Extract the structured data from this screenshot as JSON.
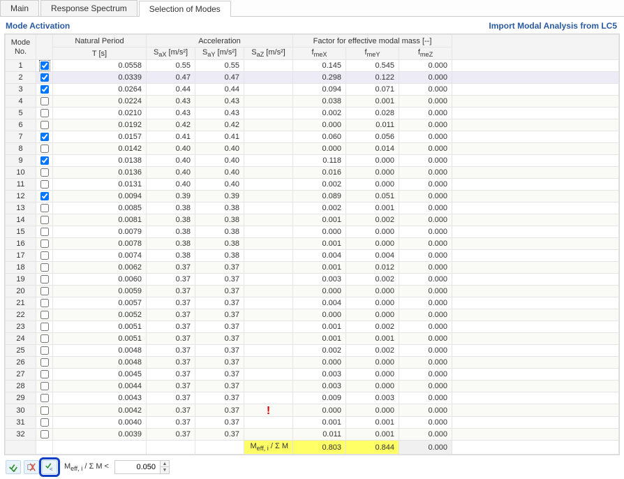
{
  "tabs": [
    "Main",
    "Response Spectrum",
    "Selection of Modes"
  ],
  "active_tab": 2,
  "subheader": {
    "left": "Mode Activation",
    "right": "Import Modal Analysis from LC5"
  },
  "headers": {
    "mode": "Mode\nNo.",
    "period_group": "Natural Period",
    "period_sub": "T [s]",
    "accel_group": "Acceleration",
    "sax": "SaX [m/s²]",
    "say": "SaY [m/s²]",
    "saz": "SaZ [m/s²]",
    "factor_group": "Factor for effective modal mass [--]",
    "fmex": "fmeX",
    "fmey": "fmeY",
    "fmez": "fmeZ"
  },
  "selected_row": 2,
  "ex_row": 30,
  "rows": [
    {
      "no": 1,
      "chk": true,
      "focus": true,
      "T": "0.0558",
      "sax": "0.55",
      "say": "0.55",
      "fmex": "0.145",
      "fmey": "0.545",
      "fmez": "0.000"
    },
    {
      "no": 2,
      "chk": true,
      "T": "0.0339",
      "sax": "0.47",
      "say": "0.47",
      "fmex": "0.298",
      "fmey": "0.122",
      "fmez": "0.000"
    },
    {
      "no": 3,
      "chk": true,
      "T": "0.0264",
      "sax": "0.44",
      "say": "0.44",
      "fmex": "0.094",
      "fmey": "0.071",
      "fmez": "0.000"
    },
    {
      "no": 4,
      "chk": false,
      "T": "0.0224",
      "sax": "0.43",
      "say": "0.43",
      "fmex": "0.038",
      "fmey": "0.001",
      "fmez": "0.000"
    },
    {
      "no": 5,
      "chk": false,
      "T": "0.0210",
      "sax": "0.43",
      "say": "0.43",
      "fmex": "0.002",
      "fmey": "0.028",
      "fmez": "0.000"
    },
    {
      "no": 6,
      "chk": false,
      "T": "0.0192",
      "sax": "0.42",
      "say": "0.42",
      "fmex": "0.000",
      "fmey": "0.011",
      "fmez": "0.000"
    },
    {
      "no": 7,
      "chk": true,
      "T": "0.0157",
      "sax": "0.41",
      "say": "0.41",
      "fmex": "0.060",
      "fmey": "0.056",
      "fmez": "0.000"
    },
    {
      "no": 8,
      "chk": false,
      "T": "0.0142",
      "sax": "0.40",
      "say": "0.40",
      "fmex": "0.000",
      "fmey": "0.014",
      "fmez": "0.000"
    },
    {
      "no": 9,
      "chk": true,
      "T": "0.0138",
      "sax": "0.40",
      "say": "0.40",
      "fmex": "0.118",
      "fmey": "0.000",
      "fmez": "0.000"
    },
    {
      "no": 10,
      "chk": false,
      "T": "0.0136",
      "sax": "0.40",
      "say": "0.40",
      "fmex": "0.016",
      "fmey": "0.000",
      "fmez": "0.000"
    },
    {
      "no": 11,
      "chk": false,
      "T": "0.0131",
      "sax": "0.40",
      "say": "0.40",
      "fmex": "0.002",
      "fmey": "0.000",
      "fmez": "0.000"
    },
    {
      "no": 12,
      "chk": true,
      "T": "0.0094",
      "sax": "0.39",
      "say": "0.39",
      "fmex": "0.089",
      "fmey": "0.051",
      "fmez": "0.000"
    },
    {
      "no": 13,
      "chk": false,
      "T": "0.0085",
      "sax": "0.38",
      "say": "0.38",
      "fmex": "0.002",
      "fmey": "0.001",
      "fmez": "0.000"
    },
    {
      "no": 14,
      "chk": false,
      "T": "0.0081",
      "sax": "0.38",
      "say": "0.38",
      "fmex": "0.001",
      "fmey": "0.002",
      "fmez": "0.000"
    },
    {
      "no": 15,
      "chk": false,
      "T": "0.0079",
      "sax": "0.38",
      "say": "0.38",
      "fmex": "0.000",
      "fmey": "0.000",
      "fmez": "0.000"
    },
    {
      "no": 16,
      "chk": false,
      "T": "0.0078",
      "sax": "0.38",
      "say": "0.38",
      "fmex": "0.001",
      "fmey": "0.000",
      "fmez": "0.000"
    },
    {
      "no": 17,
      "chk": false,
      "T": "0.0074",
      "sax": "0.38",
      "say": "0.38",
      "fmex": "0.004",
      "fmey": "0.004",
      "fmez": "0.000"
    },
    {
      "no": 18,
      "chk": false,
      "T": "0.0062",
      "sax": "0.37",
      "say": "0.37",
      "fmex": "0.001",
      "fmey": "0.012",
      "fmez": "0.000"
    },
    {
      "no": 19,
      "chk": false,
      "T": "0.0060",
      "sax": "0.37",
      "say": "0.37",
      "fmex": "0.003",
      "fmey": "0.002",
      "fmez": "0.000"
    },
    {
      "no": 20,
      "chk": false,
      "T": "0.0059",
      "sax": "0.37",
      "say": "0.37",
      "fmex": "0.000",
      "fmey": "0.000",
      "fmez": "0.000"
    },
    {
      "no": 21,
      "chk": false,
      "T": "0.0057",
      "sax": "0.37",
      "say": "0.37",
      "fmex": "0.004",
      "fmey": "0.000",
      "fmez": "0.000"
    },
    {
      "no": 22,
      "chk": false,
      "T": "0.0052",
      "sax": "0.37",
      "say": "0.37",
      "fmex": "0.000",
      "fmey": "0.000",
      "fmez": "0.000"
    },
    {
      "no": 23,
      "chk": false,
      "T": "0.0051",
      "sax": "0.37",
      "say": "0.37",
      "fmex": "0.001",
      "fmey": "0.002",
      "fmez": "0.000"
    },
    {
      "no": 24,
      "chk": false,
      "T": "0.0051",
      "sax": "0.37",
      "say": "0.37",
      "fmex": "0.001",
      "fmey": "0.001",
      "fmez": "0.000"
    },
    {
      "no": 25,
      "chk": false,
      "T": "0.0048",
      "sax": "0.37",
      "say": "0.37",
      "fmex": "0.002",
      "fmey": "0.002",
      "fmez": "0.000"
    },
    {
      "no": 26,
      "chk": false,
      "T": "0.0048",
      "sax": "0.37",
      "say": "0.37",
      "fmex": "0.000",
      "fmey": "0.000",
      "fmez": "0.000"
    },
    {
      "no": 27,
      "chk": false,
      "T": "0.0045",
      "sax": "0.37",
      "say": "0.37",
      "fmex": "0.003",
      "fmey": "0.000",
      "fmez": "0.000"
    },
    {
      "no": 28,
      "chk": false,
      "T": "0.0044",
      "sax": "0.37",
      "say": "0.37",
      "fmex": "0.003",
      "fmey": "0.000",
      "fmez": "0.000"
    },
    {
      "no": 29,
      "chk": false,
      "T": "0.0043",
      "sax": "0.37",
      "say": "0.37",
      "fmex": "0.009",
      "fmey": "0.003",
      "fmez": "0.000"
    },
    {
      "no": 30,
      "chk": false,
      "T": "0.0042",
      "sax": "0.37",
      "say": "0.37",
      "fmex": "0.000",
      "fmey": "0.000",
      "fmez": "0.000"
    },
    {
      "no": 31,
      "chk": false,
      "T": "0.0040",
      "sax": "0.37",
      "say": "0.37",
      "fmex": "0.001",
      "fmey": "0.001",
      "fmez": "0.000"
    },
    {
      "no": 32,
      "chk": false,
      "T": "0.0039",
      "sax": "0.37",
      "say": "0.37",
      "fmex": "0.011",
      "fmey": "0.001",
      "fmez": "0.000"
    }
  ],
  "summary": {
    "label": "Meff, i / Σ M",
    "fmex": "0.803",
    "fmey": "0.844",
    "fmez": "0.000"
  },
  "bottom": {
    "criteria_label": "Meff, i / Σ M <",
    "criteria_value": "0.050"
  }
}
